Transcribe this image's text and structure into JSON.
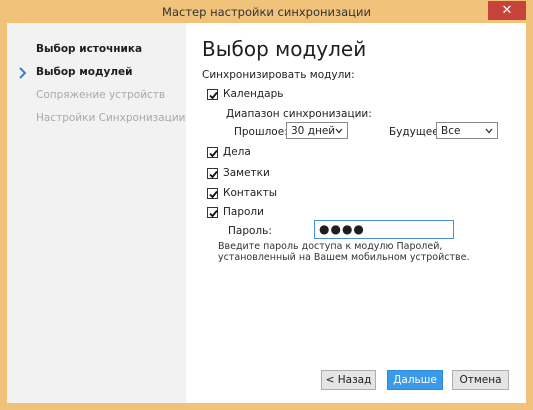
{
  "window": {
    "title": "Мастер настройки синхронизации",
    "close_label": "✕"
  },
  "sidebar": {
    "items": [
      {
        "label": "Выбор источника"
      },
      {
        "label": "Выбор модулей"
      },
      {
        "label": "Сопряжение устройств"
      },
      {
        "label": "Настройки Синхронизации"
      }
    ]
  },
  "main": {
    "title": "Выбор модулей",
    "sync_modules_label": "Синхронизировать модули:",
    "calendar": {
      "label": "Календарь",
      "checked": true
    },
    "sync_range_label": "Диапазон синхронизации:",
    "past": {
      "label": "Прошлое:",
      "value": "30 дней"
    },
    "future": {
      "label": "Будущее:",
      "value": "Все"
    },
    "tasks": {
      "label": "Дела",
      "checked": true
    },
    "notes": {
      "label": "Заметки",
      "checked": true
    },
    "contacts": {
      "label": "Контакты",
      "checked": true
    },
    "passwords": {
      "label": "Пароли",
      "checked": true
    },
    "password_field": {
      "label": "Пароль:",
      "value": "●●●●"
    },
    "hint": "Введите пароль доступа к модулю Паролей, установленный на Вашем мобильном устройстве."
  },
  "buttons": {
    "back": "< Назад",
    "next": "Дальше >",
    "cancel": "Отмена"
  },
  "colors": {
    "titlebar": "#f0c27a",
    "accent": "#3c9be8",
    "close": "#c7423a"
  }
}
